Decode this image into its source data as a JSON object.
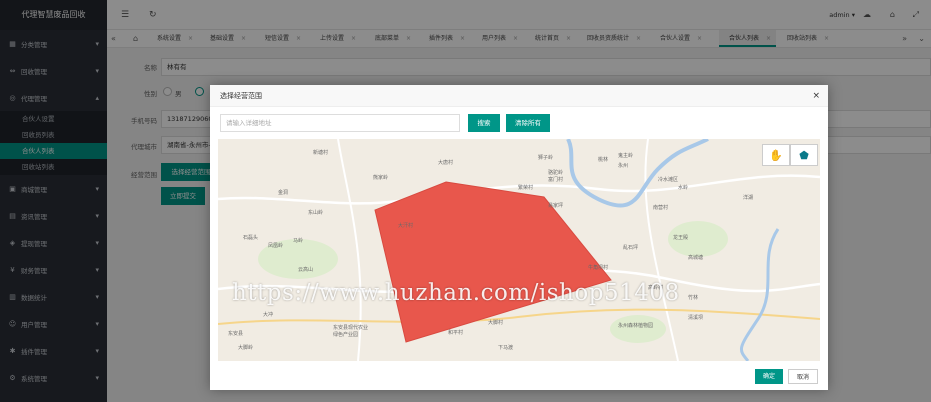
{
  "sidebar": {
    "title": "代理智慧废品回收",
    "menu": [
      {
        "label": "分类管理",
        "icon": "grid-icon"
      },
      {
        "label": "回收管理",
        "icon": "link-icon"
      },
      {
        "label": "代理管理",
        "icon": "target-icon",
        "expanded": true
      }
    ],
    "submenu": [
      {
        "label": "合伙人设置"
      },
      {
        "label": "回收员列表"
      },
      {
        "label": "合伙人列表",
        "active": true
      },
      {
        "label": "回收站列表"
      }
    ],
    "menu_after": [
      {
        "label": "商城管理",
        "icon": "cart-icon"
      },
      {
        "label": "资讯管理",
        "icon": "document-icon"
      },
      {
        "label": "提现管理",
        "icon": "wallet-icon"
      },
      {
        "label": "财务管理",
        "icon": "money-icon"
      },
      {
        "label": "数据统计",
        "icon": "chart-icon"
      },
      {
        "label": "用户管理",
        "icon": "user-icon"
      },
      {
        "label": "插件管理",
        "icon": "plugin-icon"
      },
      {
        "label": "系统管理",
        "icon": "gear-icon"
      }
    ]
  },
  "topbar": {
    "user": "admin ▾"
  },
  "tabs": [
    "系统设置",
    "基础设置",
    "短信设置",
    "上传设置",
    "底部菜单",
    "插件列表",
    "用户列表",
    "统计首页",
    "回收员资质统计",
    "合伙人设置",
    "合伙人列表",
    "回收站列表"
  ],
  "active_tab": "合伙人列表",
  "form": {
    "name_label": "名称",
    "name_value": "林有有",
    "gender_label": "性别",
    "gender_option_male": "男",
    "phone_label": "手机号码",
    "phone_value": "13187129060",
    "city_label": "代理城市",
    "city_value": "湖南省-永州市-冷",
    "range_label": "经营范围",
    "range_button": "选择经营范围",
    "submit_button": "立即提交"
  },
  "modal": {
    "title": "选择经营范围",
    "close": "×",
    "address_placeholder": "请输入详细地址",
    "search_button": "搜索",
    "clear_button": "清除所有",
    "confirm_button": "确定",
    "cancel_button": "取消"
  },
  "map": {
    "polygon_color": "#e8574c",
    "places": [
      "大唐村",
      "鬼主岭",
      "富门村",
      "狮子岭",
      "繁荣村",
      "骆驼岭",
      "南营村",
      "桃林",
      "永州",
      "云高山",
      "东安县",
      "大脚岭",
      "大冲",
      "东安县现代农业",
      "绿色产业园",
      "水岭",
      "龙王殿",
      "高城塘",
      "牛角坝村",
      "清溪坝",
      "高岭村",
      "竹林",
      "永州森林植物园",
      "下马渡",
      "冷水滩区",
      "金洞",
      "东山岭",
      "大汗村",
      "石磊头",
      "凤凰岭",
      "易家坪",
      "乱石坪",
      "马岭",
      "大脚村",
      "洋湖",
      "和平村",
      "熊家岭",
      "新塘村"
    ],
    "tool_hand": "hand-icon",
    "tool_polygon": "polygon-icon"
  },
  "watermark": "https://www.huzhan.com/ishop51408"
}
